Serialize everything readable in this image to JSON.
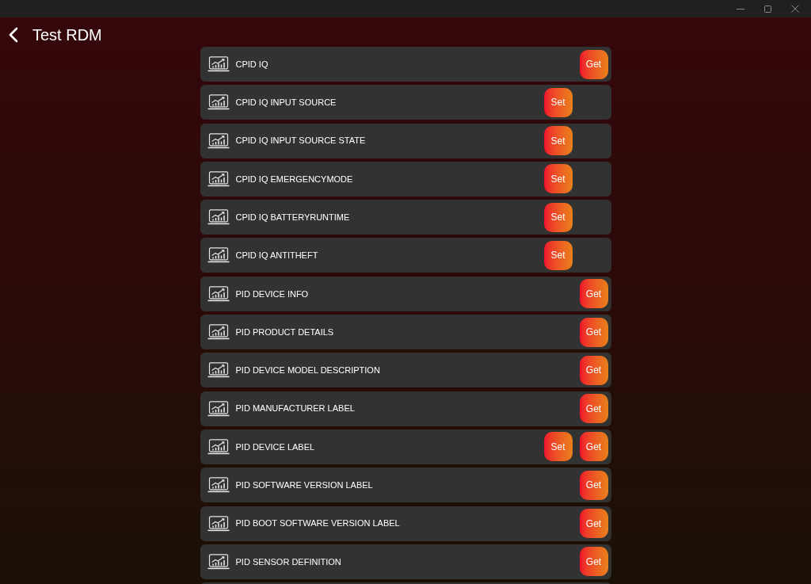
{
  "header": {
    "title": "Test RDM"
  },
  "rows": [
    {
      "label": "CPID IQ",
      "actions": [
        {
          "kind": "get",
          "label": "Get"
        }
      ]
    },
    {
      "label": "CPID IQ INPUT SOURCE",
      "actions": [
        {
          "kind": "set",
          "label": "Set"
        }
      ]
    },
    {
      "label": "CPID IQ INPUT SOURCE STATE",
      "actions": [
        {
          "kind": "set",
          "label": "Set"
        }
      ]
    },
    {
      "label": "CPID IQ EMERGENCYMODE",
      "actions": [
        {
          "kind": "set",
          "label": "Set"
        }
      ]
    },
    {
      "label": "CPID IQ BATTERYRUNTIME",
      "actions": [
        {
          "kind": "set",
          "label": "Set"
        }
      ]
    },
    {
      "label": "CPID IQ ANTITHEFT",
      "actions": [
        {
          "kind": "set",
          "label": "Set"
        }
      ]
    },
    {
      "label": "PID DEVICE INFO",
      "actions": [
        {
          "kind": "get",
          "label": "Get"
        }
      ]
    },
    {
      "label": "PID PRODUCT DETAILS",
      "actions": [
        {
          "kind": "get",
          "label": "Get"
        }
      ]
    },
    {
      "label": "PID DEVICE MODEL DESCRIPTION",
      "actions": [
        {
          "kind": "get",
          "label": "Get"
        }
      ]
    },
    {
      "label": "PID MANUFACTURER LABEL",
      "actions": [
        {
          "kind": "get",
          "label": "Get"
        }
      ]
    },
    {
      "label": "PID DEVICE LABEL",
      "actions": [
        {
          "kind": "set",
          "label": "Set"
        },
        {
          "kind": "get",
          "label": "Get"
        }
      ]
    },
    {
      "label": "PID SOFTWARE VERSION LABEL",
      "actions": [
        {
          "kind": "get",
          "label": "Get"
        }
      ]
    },
    {
      "label": "PID BOOT SOFTWARE VERSION LABEL",
      "actions": [
        {
          "kind": "get",
          "label": "Get"
        }
      ]
    },
    {
      "label": "PID SENSOR DEFINITION",
      "actions": [
        {
          "kind": "get",
          "label": "Get"
        }
      ]
    }
  ]
}
